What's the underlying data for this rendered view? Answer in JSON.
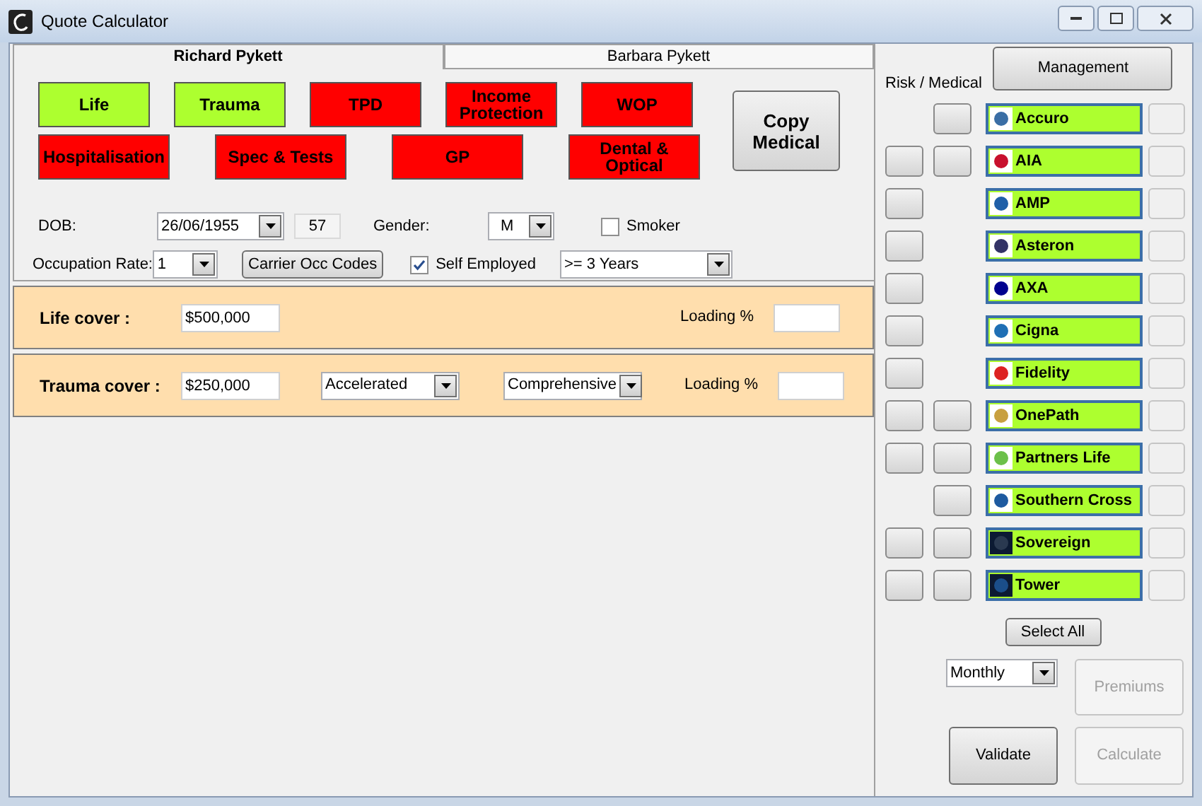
{
  "window": {
    "title": "Quote Calculator"
  },
  "tabs": [
    {
      "label": "Richard Pykett",
      "selected": true
    },
    {
      "label": "Barbara Pykett",
      "selected": false
    }
  ],
  "benefit_rows": [
    [
      {
        "label": "Life",
        "selected": true
      },
      {
        "label": "Trauma",
        "selected": true
      },
      {
        "label": "TPD",
        "selected": false
      },
      {
        "label": "Income Protection",
        "selected": false
      },
      {
        "label": "WOP",
        "selected": false
      }
    ],
    [
      {
        "label": "Hospitalisation",
        "selected": false
      },
      {
        "label": "Spec & Tests",
        "selected": false
      },
      {
        "label": "GP",
        "selected": false
      },
      {
        "label": "Dental & Optical",
        "selected": false
      }
    ]
  ],
  "copy_medical_button": "Copy Medical",
  "dob": {
    "label": "DOB:",
    "value": "26/06/1955",
    "age": "57"
  },
  "gender": {
    "label": "Gender:",
    "value": "M"
  },
  "smoker": {
    "label": "Smoker",
    "checked": false
  },
  "occupation_rate": {
    "label": "Occupation Rate:",
    "value": "1"
  },
  "carrier_occ_codes_button": "Carrier Occ Codes",
  "self_employed": {
    "label": "Self Employed",
    "checked": true,
    "duration": ">= 3 Years"
  },
  "covers": [
    {
      "kind": "life",
      "label": "Life cover :",
      "amount": "$500,000",
      "loading_label": "Loading %"
    },
    {
      "kind": "trauma",
      "label": "Trauma cover :",
      "amount": "$250,000",
      "type": "Accelerated",
      "level": "Comprehensive",
      "loading_label": "Loading %"
    }
  ],
  "management_button": "Management",
  "risk_medical_header": "Risk / Medical",
  "carriers": [
    {
      "name": "Accuro",
      "risk": false,
      "medical": true,
      "selected": true
    },
    {
      "name": "AIA",
      "risk": true,
      "medical": true,
      "selected": true
    },
    {
      "name": "AMP",
      "risk": true,
      "medical": false,
      "selected": true
    },
    {
      "name": "Asteron",
      "risk": true,
      "medical": false,
      "selected": true
    },
    {
      "name": "AXA",
      "risk": true,
      "medical": false,
      "selected": true
    },
    {
      "name": "Cigna",
      "risk": true,
      "medical": false,
      "selected": true
    },
    {
      "name": "Fidelity",
      "risk": true,
      "medical": false,
      "selected": true
    },
    {
      "name": "OnePath",
      "risk": true,
      "medical": true,
      "selected": true
    },
    {
      "name": "Partners Life",
      "risk": true,
      "medical": true,
      "selected": true
    },
    {
      "name": "Southern Cross",
      "risk": false,
      "medical": true,
      "selected": true
    },
    {
      "name": "Sovereign",
      "risk": true,
      "medical": true,
      "selected": true
    },
    {
      "name": "Tower",
      "risk": true,
      "medical": true,
      "selected": true
    }
  ],
  "select_all_button": "Select All",
  "frequency": "Monthly",
  "premiums_button": {
    "label": "Premiums",
    "disabled": true
  },
  "validate_button": {
    "label": "Validate",
    "disabled": false
  },
  "calculate_button": {
    "label": "Calculate",
    "disabled": true
  }
}
